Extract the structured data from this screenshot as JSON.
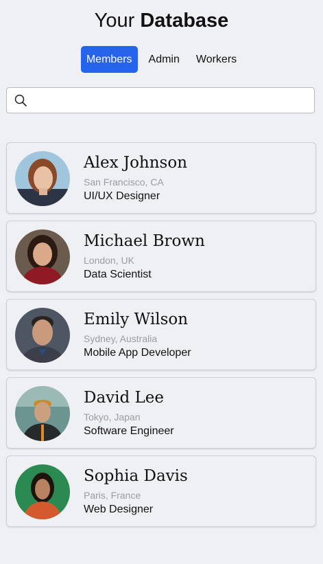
{
  "header": {
    "title_light": "Your",
    "title_bold": "Database"
  },
  "tabs": [
    {
      "label": "Members",
      "active": true
    },
    {
      "label": "Admin",
      "active": false
    },
    {
      "label": "Workers",
      "active": false
    }
  ],
  "search": {
    "value": "",
    "placeholder": "",
    "icon": "search-icon"
  },
  "members": [
    {
      "name": "Alex Johnson",
      "location": "San Francisco, CA",
      "role": "UI/UX Designer"
    },
    {
      "name": "Michael Brown",
      "location": "London, UK",
      "role": "Data Scientist"
    },
    {
      "name": "Emily Wilson",
      "location": "Sydney, Australia",
      "role": "Mobile App Developer"
    },
    {
      "name": "David Lee",
      "location": "Tokyo, Japan",
      "role": "Software Engineer"
    },
    {
      "name": "Sophia Davis",
      "location": "Paris, France",
      "role": "Web Designer"
    }
  ],
  "colors": {
    "accent": "#2563eb",
    "background": "#eff0f3",
    "muted_text": "#9a9ca3"
  }
}
